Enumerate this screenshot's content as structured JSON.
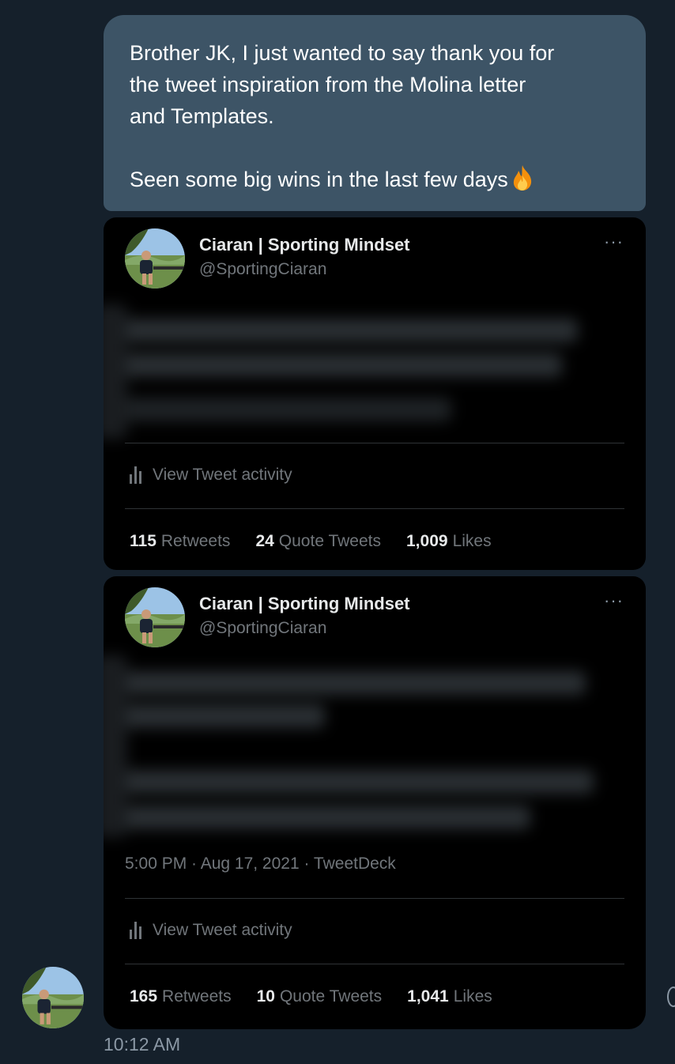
{
  "message": {
    "text_line1": "Brother JK, I just wanted to say thank you for",
    "text_line2": "the tweet inspiration from the Molina letter",
    "text_line3": "and Templates.",
    "text_line4": "Seen some big wins in the last few days",
    "emoji": "fire-icon",
    "timestamp": "10:12 AM"
  },
  "tweets": [
    {
      "author_name": "Ciaran | Sporting Mindset",
      "author_handle": "@SportingCiaran",
      "more_label": "···",
      "activity_label": "View Tweet activity",
      "stats": [
        {
          "value": "115",
          "label": "Retweets"
        },
        {
          "value": "24",
          "label": "Quote Tweets"
        },
        {
          "value": "1,009",
          "label": "Likes"
        }
      ]
    },
    {
      "author_name": "Ciaran | Sporting Mindset",
      "author_handle": "@SportingCiaran",
      "more_label": "···",
      "meta": "5:00 PM · Aug 17, 2021 · TweetDeck",
      "activity_label": "View Tweet activity",
      "stats": [
        {
          "value": "165",
          "label": "Retweets"
        },
        {
          "value": "10",
          "label": "Quote Tweets"
        },
        {
          "value": "1,041",
          "label": "Likes"
        }
      ]
    }
  ],
  "colors": {
    "background": "#15202b",
    "bubble": "#3d5466",
    "card": "#000000",
    "muted_text": "#71767b"
  }
}
